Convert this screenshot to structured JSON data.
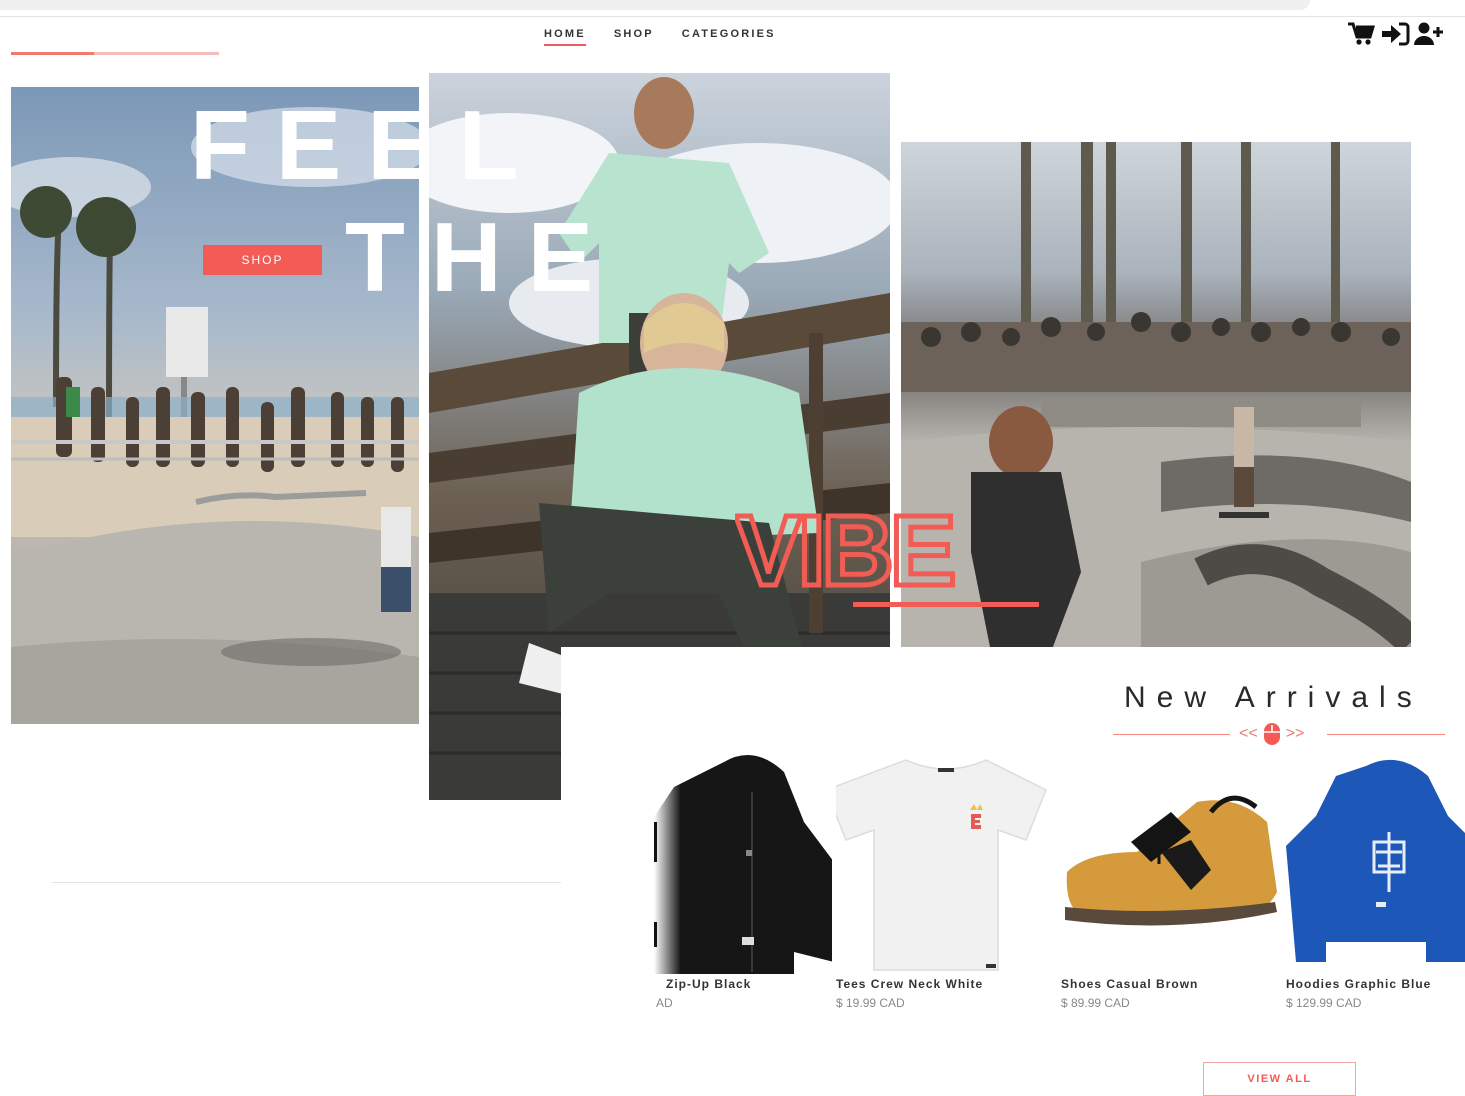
{
  "nav": {
    "items": [
      {
        "label": "HOME",
        "active": true
      },
      {
        "label": "SHOP",
        "active": false
      },
      {
        "label": "CATEGORIES",
        "active": false
      }
    ]
  },
  "header_icons": [
    "cart-icon",
    "sign-in-icon",
    "add-user-icon"
  ],
  "hero": {
    "line1": "FEEL",
    "line2": "THE",
    "line3": "VIBE",
    "shop_button": "SHOP",
    "slide_progress": 0.4
  },
  "colors": {
    "accent": "#f25c54",
    "text": "#2a2a2a",
    "muted": "#888888"
  },
  "arrivals": {
    "title": "New Arrivals",
    "prev_symbol": "<<",
    "next_symbol": ">>",
    "mouse_icon": "mouse-icon",
    "products": [
      {
        "name": "Zip-Up Black",
        "price": "AD"
      },
      {
        "name": "Tees Crew Neck White",
        "price": "$ 19.99 CAD"
      },
      {
        "name": "Shoes Casual Brown",
        "price": "$ 89.99 CAD"
      },
      {
        "name": "Hoodies Graphic Blue",
        "price": "$ 129.99 CAD"
      }
    ],
    "view_all": "VIEW ALL"
  }
}
